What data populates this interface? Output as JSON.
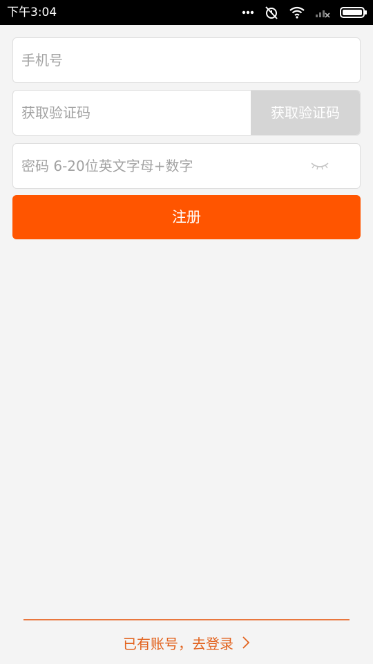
{
  "status_bar": {
    "time": "下午3:04",
    "icons": [
      "more-dots-icon",
      "alarm-off-icon",
      "wifi-icon",
      "signal-icon",
      "battery-icon"
    ]
  },
  "form": {
    "phone": {
      "placeholder": "手机号",
      "value": ""
    },
    "code": {
      "placeholder": "获取验证码",
      "value": "",
      "button_label": "获取验证码"
    },
    "password": {
      "placeholder": "密码 6-20位英文字母+数字",
      "value": "",
      "toggle_icon": "eye-closed-icon"
    },
    "register_label": "注册"
  },
  "footer": {
    "login_link": "已有账号，去登录",
    "link_icon": "chevron-right-icon"
  },
  "colors": {
    "accent": "#ff5500",
    "link": "#e2621d",
    "disabled_button": "#d5d5d5",
    "background": "#f4f4f4"
  }
}
